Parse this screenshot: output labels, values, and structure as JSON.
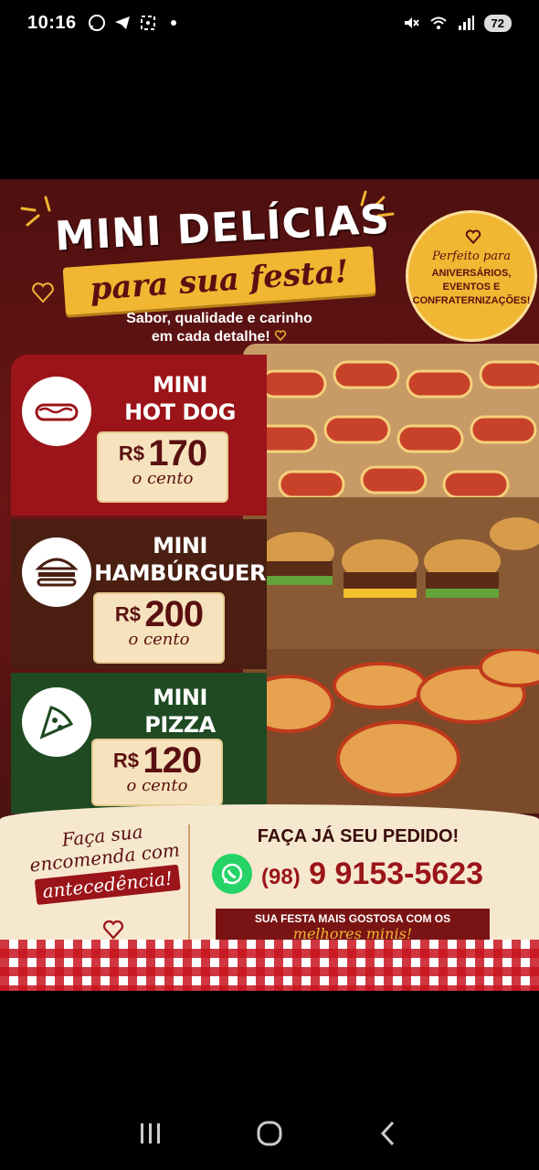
{
  "status_bar": {
    "time": "10:16",
    "battery": "72",
    "left_icons": [
      "whatsapp-icon",
      "telegram-icon",
      "screenshot-icon",
      "dot-icon"
    ],
    "right_icons": [
      "mute-icon",
      "wifi-icon",
      "signal-icon",
      "battery-icon"
    ]
  },
  "poster": {
    "title": "MINI DELÍCIAS",
    "subtitle": "para sua festa!",
    "tagline_line1": "Sabor, qualidade e carinho",
    "tagline_line2": "em cada detalhe!",
    "badge": {
      "line1": "Perfeito para",
      "line2": "ANIVERSÁRIOS,",
      "line3": "EVENTOS E",
      "line4": "CONFRATERNIZAÇÕES!"
    },
    "items": [
      {
        "name_line1": "MINI",
        "name_line2": "HOT DOG",
        "currency": "R$",
        "price": "170",
        "unit": "o cento",
        "icon": "hotdog-icon"
      },
      {
        "name_line1": "MINI",
        "name_line2": "HAMBÚRGUER",
        "currency": "R$",
        "price": "200",
        "unit": "o cento",
        "icon": "burger-icon"
      },
      {
        "name_line1": "MINI",
        "name_line2": "PIZZA",
        "currency": "R$",
        "price": "120",
        "unit": "o cento",
        "icon": "pizza-icon"
      }
    ],
    "footer": {
      "note_line1": "Faça sua",
      "note_line2": "encomenda com",
      "note_line3": "antecedência!",
      "cta": "FAÇA JÁ SEU PEDIDO!",
      "phone_ddd": "(98)",
      "phone_number": "9 9153-5623",
      "slogan_line1": "SUA FESTA MAIS GOSTOSA COM OS",
      "slogan_line2": "melhores minis!"
    }
  },
  "colors": {
    "maroon": "#6b1515",
    "gold": "#f1b632",
    "red": "#9b1419",
    "brown": "#4a1f12",
    "green": "#1f4a22",
    "cream": "#f6e8cf"
  }
}
